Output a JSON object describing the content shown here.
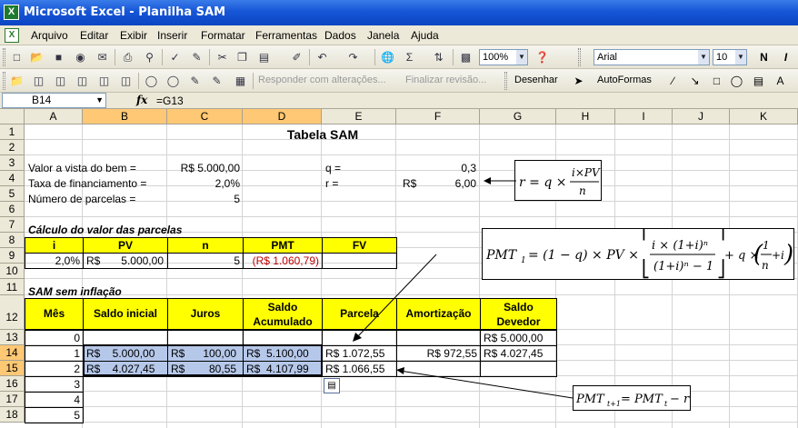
{
  "window": {
    "title": "Microsoft Excel - Planilha SAM"
  },
  "menu": [
    "Arquivo",
    "Editar",
    "Exibir",
    "Inserir",
    "Formatar",
    "Ferramentas",
    "Dados",
    "Janela",
    "Ajuda"
  ],
  "toolbar1": {
    "zoom": "100%",
    "font_name": "Arial",
    "font_size": "10",
    "bold": "N",
    "italic": "I"
  },
  "toolbar2": {
    "reply": "Responder com alterações...",
    "finish": "Finalizar revisão...",
    "draw": "Desenhar",
    "autoshapes": "AutoFormas"
  },
  "formula_bar": {
    "name_box": "B14",
    "fx": "fx",
    "formula": "=G13"
  },
  "columns": [
    "A",
    "B",
    "C",
    "D",
    "E",
    "F",
    "G",
    "H",
    "I",
    "J",
    "K"
  ],
  "rows": [
    "1",
    "2",
    "3",
    "4",
    "5",
    "6",
    "7",
    "8",
    "9",
    "10",
    "11",
    "12",
    "13",
    "14",
    "15",
    "16",
    "17",
    "18"
  ],
  "sheet": {
    "title": "Tabela SAM",
    "inputs": {
      "valor_label": "Valor a vista do bem =",
      "valor_value": "R$ 5.000,00",
      "taxa_label": "Taxa de financiamento =",
      "taxa_value": "2,0%",
      "parcelas_label": "Número de parcelas =",
      "parcelas_value": "5",
      "q_label": "q =",
      "q_value": "0,3",
      "r_label": "r =",
      "r_currency": "R$",
      "r_value": "6,00"
    },
    "calc_title": "Cálculo do valor das parcelas",
    "calc_headers": [
      "i",
      "PV",
      "n",
      "PMT",
      "FV"
    ],
    "calc_row": {
      "i": "2,0%",
      "pv_currency": "R$",
      "pv": "5.000,00",
      "n": "5",
      "pmt": "(R$ 1.060,79)",
      "fv": ""
    },
    "sam_title": "SAM sem inflação",
    "sam_headers": [
      "Mês",
      "Saldo inicial",
      "Juros",
      "Saldo Acumulado",
      "Parcela",
      "Amortização",
      "Saldo Devedor"
    ],
    "sam_rows": [
      {
        "mes": "0",
        "saldo_inicial": "",
        "juros": "",
        "saldo_acumulado": "",
        "parcela": "",
        "amortizacao": "",
        "saldo_devedor": "R$ 5.000,00"
      },
      {
        "mes": "1",
        "saldo_inicial": "R$    5.000,00",
        "juros": "R$      100,00",
        "saldo_acumulado": "R$  5.100,00",
        "parcela": "R$ 1.072,55",
        "amortizacao": "R$ 972,55",
        "saldo_devedor": "R$ 4.027,45"
      },
      {
        "mes": "2",
        "saldo_inicial": "R$    4.027,45",
        "juros": "R$        80,55",
        "saldo_acumulado": "R$  4.107,99",
        "parcela": "R$ 1.066,55",
        "amortizacao": "",
        "saldo_devedor": ""
      },
      {
        "mes": "3"
      },
      {
        "mes": "4"
      },
      {
        "mes": "5"
      }
    ]
  }
}
